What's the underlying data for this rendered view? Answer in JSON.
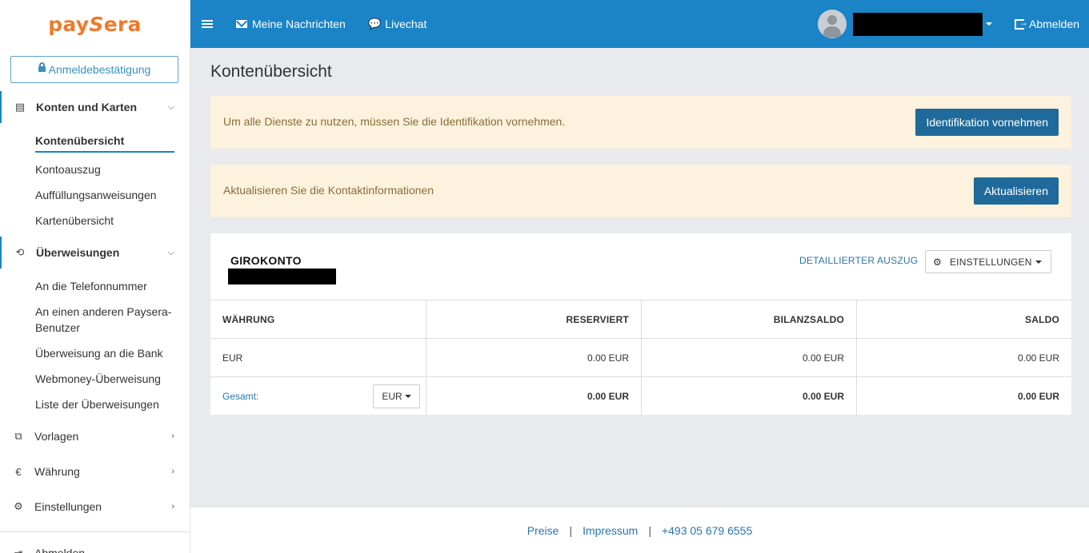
{
  "logo": {
    "part1": "pay",
    "part2": "S",
    "part3": "era"
  },
  "sidebar": {
    "confirm_label": "Anmeldebestätigung",
    "sections": [
      {
        "label": "Konten und Karten",
        "icon": "cards-icon"
      },
      {
        "label": "Überweisungen",
        "icon": "transfer-icon"
      },
      {
        "label": "Vorlagen",
        "icon": "copy-icon"
      },
      {
        "label": "Währung",
        "icon": "euro-icon"
      },
      {
        "label": "Einstellungen",
        "icon": "gear-icon"
      },
      {
        "label": "Abmelden",
        "icon": "logout-icon"
      }
    ],
    "accounts_items": [
      "Kontenübersicht",
      "Kontoauszug",
      "Auffüllungsanweisungen",
      "Kartenübersicht"
    ],
    "transfer_items": [
      "An die Telefonnummer",
      "An einen anderen Paysera-Benutzer",
      "Überweisung an die Bank",
      "Webmoney-Überweisung",
      "Liste der Überweisungen"
    ]
  },
  "topbar": {
    "messages": "Meine Nachrichten",
    "livechat": "Livechat",
    "logout": "Abmelden"
  },
  "main": {
    "title": "Kontenübersicht",
    "alert1": {
      "message": "Um alle Dienste zu nutzen, müssen Sie die Identifikation vornehmen.",
      "button": "Identifikation vornehmen"
    },
    "alert2": {
      "message": "Aktualisieren Sie die Kontaktinformationen",
      "button": "Aktualisieren"
    },
    "account": {
      "title": "GIROKONTO",
      "detail_link": "DETAILLIERTER AUSZUG",
      "settings": "EINSTELLUNGEN",
      "table": {
        "headers": [
          "WÄHRUNG",
          "RESERVIERT",
          "BILANZSALDO",
          "SALDO"
        ],
        "rows": [
          [
            "EUR",
            "0.00 EUR",
            "0.00 EUR",
            "0.00 EUR"
          ]
        ],
        "total": {
          "label": "Gesamt:",
          "currency": "EUR",
          "values": [
            "0.00 EUR",
            "0.00 EUR",
            "0.00 EUR"
          ]
        }
      }
    }
  },
  "footer": {
    "links": [
      "Preise",
      "Impressum",
      "+493 05 679 6555"
    ]
  },
  "colors": {
    "brand": "#1a84c7",
    "logo": "#ee7a2b",
    "button": "#1f6a9a",
    "alert_bg": "#fcf2dd"
  }
}
